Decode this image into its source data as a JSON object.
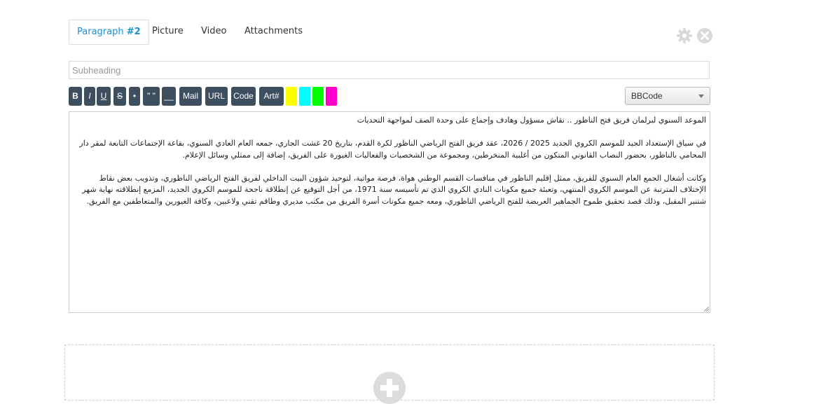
{
  "tabs": {
    "paragraph_prefix": "Paragraph ",
    "paragraph_number": "#2",
    "picture": "Picture",
    "video": "Video",
    "attachments": "Attachments"
  },
  "icons": {
    "settings": "gear-icon",
    "close": "close-icon",
    "add": "plus-circle-icon"
  },
  "subheading": {
    "placeholder": "Subheading",
    "value": ""
  },
  "toolbar": {
    "bold": "B",
    "italic": "I",
    "underline": "U",
    "strike": "S",
    "bullet": "•",
    "quote": "\" \"",
    "hr": "__",
    "mail": "Mail",
    "url": "URL",
    "code": "Code",
    "art": "Art#",
    "swatch_yellow": "",
    "swatch_cyan": "",
    "swatch_green": "",
    "swatch_magenta": ""
  },
  "colors": {
    "accent": "#1b8fd1",
    "button": "#3d4f5f",
    "yellow": "#ffff00",
    "cyan": "#00ffff",
    "green": "#00ff00",
    "magenta": "#ff00cc"
  },
  "format_select": {
    "value": "BBCode"
  },
  "editor": {
    "line1": "الموعد السنوي لبرلمان فريق فتح الناظور .. نقاش مسؤول وهادف وإجماع على وحدة الصف لمواجهة التحديات",
    "para1": "في سياق الإستعداد الجيد للموسم الكروي الجديد 2025 / 2026، عقد فريق الفتح الرياضي الناظور لكرة القدم، بتاريخ 20 غشت الجاري، جمعه العام العادي السنوي، بقاعة الإجتماعات التابعة لمقر دار المحامي بالناظور، بحضور النصاب القانوني المتكون من أغلبية المنخرطين، ومجموعة من الشخصيات والفعاليات الغيورة على الفريق، إضافة إلى ممثلي وسائل الإعلام.",
    "para2": "وكانت أشغال الجمع العام السنوي للفريق، ممثل إقليم الناظور في منافسات القسم الوطني هواة، فرصة مواتية، لتوحيد شؤون البيت الداخلي لفريق الفتح الرياضي الناظوري، وتذويب بعض نقاط الإختلاف المترتبة عن الموسم الكروي المنتهي، وتعبئة جميع مكونات النادي الكروي الذي تم تأسيسه سنة 1971، من أجل التوقيع عن إنطلاقة ناجحة للموسم الكروي الجديد، المزمع إنطلاقته نهاية شهر شتنبر المقبل، وذلك قصد تحقيق طموح الجماهير العريضة للفتح الرياضي الناظوري، ومعه جميع مكونات أسرة الفريق من مكتب مديري وطاقم تقني ولاعبين، وكافة الغيورين والمتعاطفين مع الفريق."
  }
}
